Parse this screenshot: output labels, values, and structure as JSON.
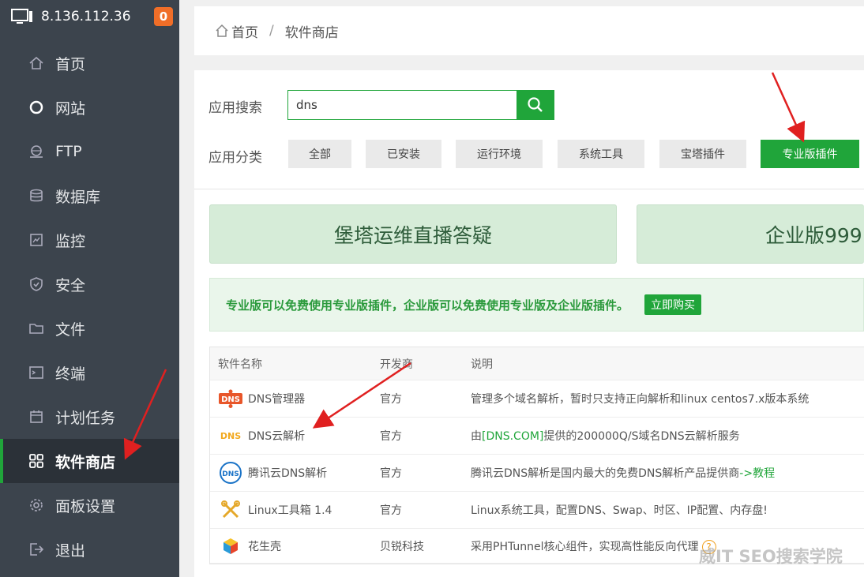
{
  "sidebar": {
    "server_ip": "8.136.112.36",
    "badge": "0",
    "items": [
      {
        "label": "首页",
        "icon": "home-icon"
      },
      {
        "label": "网站",
        "icon": "globe-icon"
      },
      {
        "label": "FTP",
        "icon": "ftp-icon"
      },
      {
        "label": "数据库",
        "icon": "database-icon"
      },
      {
        "label": "监控",
        "icon": "monitor-icon"
      },
      {
        "label": "安全",
        "icon": "shield-icon"
      },
      {
        "label": "文件",
        "icon": "folder-icon"
      },
      {
        "label": "终端",
        "icon": "terminal-icon"
      },
      {
        "label": "计划任务",
        "icon": "calendar-icon"
      },
      {
        "label": "软件商店",
        "icon": "grid-icon"
      },
      {
        "label": "面板设置",
        "icon": "gear-icon"
      },
      {
        "label": "退出",
        "icon": "logout-icon"
      }
    ],
    "active_index": 9
  },
  "breadcrumb": {
    "home": "首页",
    "sep": "/",
    "current": "软件商店"
  },
  "search": {
    "label": "应用搜索",
    "value": "dns"
  },
  "category": {
    "label": "应用分类",
    "buttons": [
      "全部",
      "已安装",
      "运行环境",
      "系统工具",
      "宝塔插件",
      "专业版插件"
    ]
  },
  "banners": [
    "堡塔运维直播答疑",
    "企业版999"
  ],
  "notice": {
    "text": "专业版可以免费使用专业版插件，企业版可以免费使用专业版及企业版插件。",
    "buy": "立即购买"
  },
  "table": {
    "headers": [
      "软件名称",
      "开发商",
      "说明"
    ],
    "rows": [
      {
        "name": "DNS管理器",
        "vendor": "官方",
        "desc": "管理多个域名解析，暂时只支持正向解析和linux centos7.x版本系统"
      },
      {
        "name": "DNS云解析",
        "vendor": "官方",
        "desc_pre": "由",
        "desc_link": "[DNS.COM]",
        "desc_post": "提供的200000Q/S域名DNS云解析服务"
      },
      {
        "name": "腾讯云DNS解析",
        "vendor": "官方",
        "desc_pre": "腾讯云DNS解析是国内最大的免费DNS解析产品提供商",
        "desc_link": "->教程"
      },
      {
        "name": "Linux工具箱 1.4",
        "vendor": "官方",
        "desc": "Linux系统工具，配置DNS、Swap、时区、IP配置、内存盘!"
      },
      {
        "name": "花生壳",
        "vendor": "贝锐科技",
        "desc": "采用PHTunnel核心组件，实现高性能反向代理",
        "help": "?"
      }
    ]
  },
  "watermark": "威IT SEO搜索学院"
}
